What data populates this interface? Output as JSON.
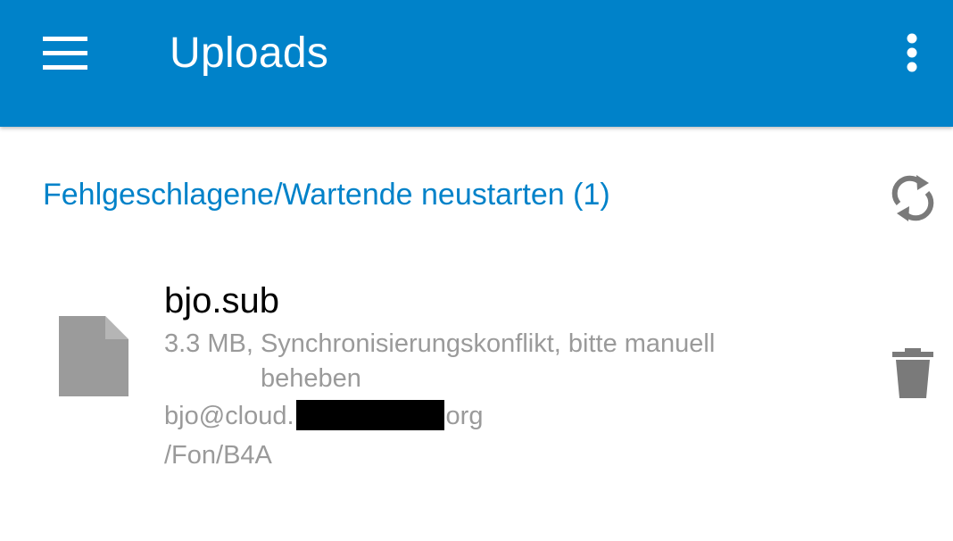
{
  "app_bar": {
    "title": "Uploads",
    "menu_icon": "hamburger-menu-icon",
    "overflow_icon": "more-vert-icon",
    "background": "#0082c9"
  },
  "section": {
    "retry_label": "Fehlgeschlagene/Wartende neustarten (1)",
    "refresh_icon": "sync-icon",
    "accent": "#0082c9"
  },
  "upload": {
    "file_name": "bjo.sub",
    "size": "3.3 MB,",
    "status": "Synchronisierungskonflikt, bitte manuell beheben",
    "account_prefix": "bjo@cloud.",
    "account_suffix": "org",
    "path": "/Fon/B4A",
    "file_icon": "generic-file-icon",
    "delete_icon": "trash-icon"
  }
}
